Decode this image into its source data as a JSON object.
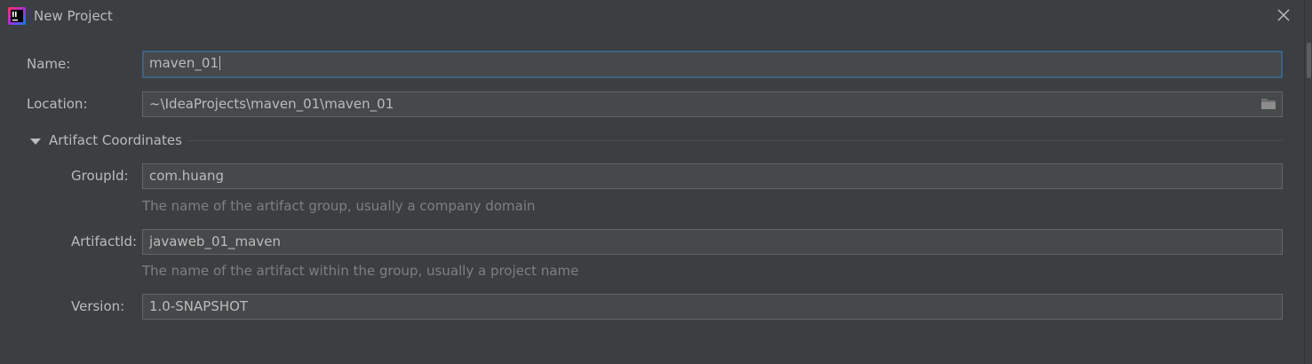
{
  "window": {
    "title": "New Project",
    "app_icon": "intellij-idea-icon",
    "close_icon": "close-icon"
  },
  "form": {
    "name": {
      "label": "Name:",
      "value": "maven_01"
    },
    "location": {
      "label": "Location:",
      "value": "~\\IdeaProjects\\maven_01\\maven_01",
      "icon": "folder-icon"
    },
    "artifact_section": {
      "title": "Artifact Coordinates",
      "expanded": true,
      "icon": "triangle-down-icon"
    },
    "group_id": {
      "label": "GroupId:",
      "value": "com.huang",
      "hint": "The name of the artifact group, usually a company domain"
    },
    "artifact_id": {
      "label": "ArtifactId:",
      "value": "javaweb_01_maven",
      "hint": "The name of the artifact within the group, usually a project name"
    },
    "version": {
      "label": "Version:",
      "value": "1.0-SNAPSHOT"
    }
  },
  "colors": {
    "background": "#3c3f41",
    "field_background": "#45494a",
    "focus_border": "#3d6185",
    "text": "#bbbbbb",
    "hint_text": "#7d7f80"
  }
}
